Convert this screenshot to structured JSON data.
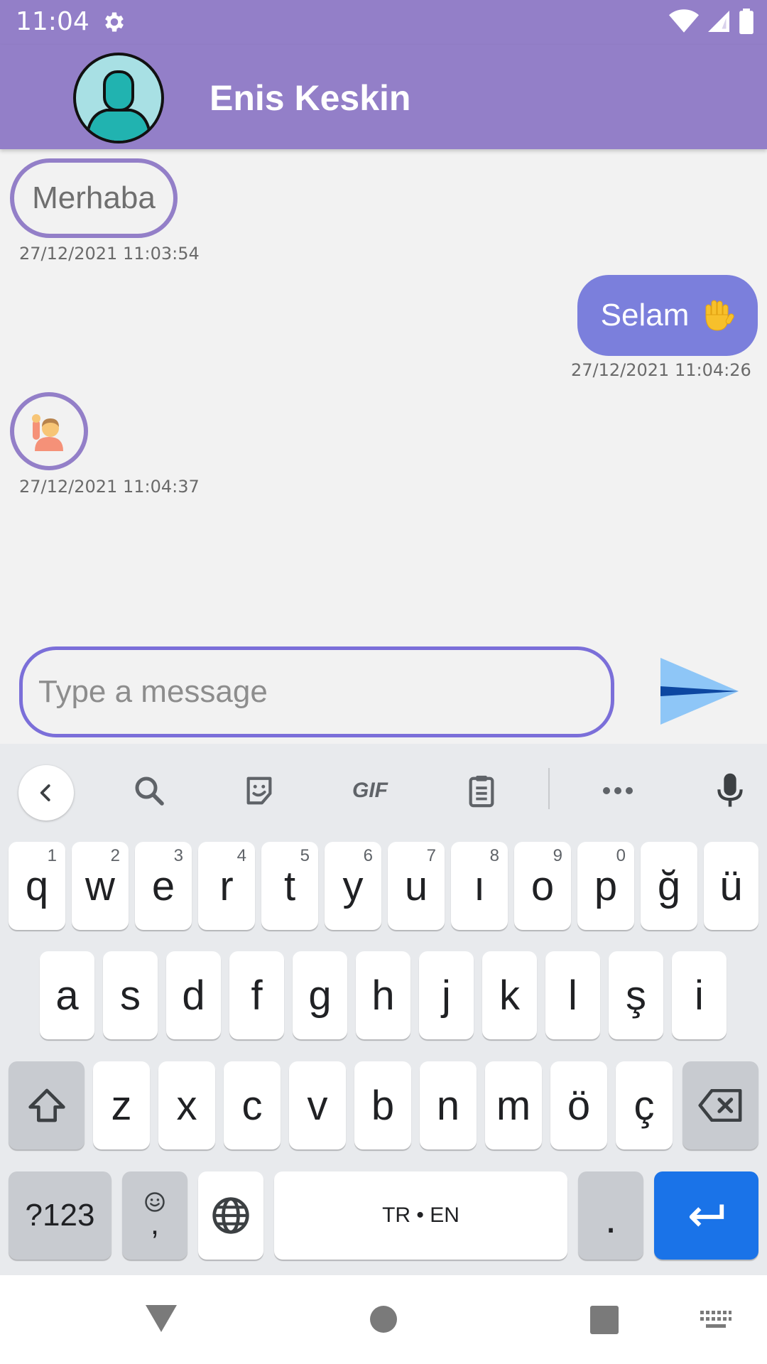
{
  "status_bar": {
    "time": "11:04"
  },
  "header": {
    "contact_name": "Enis Keskin"
  },
  "messages": [
    {
      "direction": "incoming",
      "text": "Merhaba",
      "timestamp": "27/12/2021 11:03:54"
    },
    {
      "direction": "outgoing",
      "text": "Selam",
      "emoji": "raised-hand",
      "timestamp": "27/12/2021 11:04:26"
    },
    {
      "direction": "incoming",
      "emoji": "person-raising-hand",
      "timestamp": "27/12/2021 11:04:37"
    }
  ],
  "composer": {
    "placeholder": "Type a message",
    "value": ""
  },
  "keyboard": {
    "toolbar_gif": "GIF",
    "row1": [
      {
        "key": "q",
        "hint": "1"
      },
      {
        "key": "w",
        "hint": "2"
      },
      {
        "key": "e",
        "hint": "3"
      },
      {
        "key": "r",
        "hint": "4"
      },
      {
        "key": "t",
        "hint": "5"
      },
      {
        "key": "y",
        "hint": "6"
      },
      {
        "key": "u",
        "hint": "7"
      },
      {
        "key": "ı",
        "hint": "8"
      },
      {
        "key": "o",
        "hint": "9"
      },
      {
        "key": "p",
        "hint": "0"
      },
      {
        "key": "ğ",
        "hint": ""
      },
      {
        "key": "ü",
        "hint": ""
      }
    ],
    "row2": [
      "a",
      "s",
      "d",
      "f",
      "g",
      "h",
      "j",
      "k",
      "l",
      "ş",
      "i"
    ],
    "row3": [
      "z",
      "x",
      "c",
      "v",
      "b",
      "n",
      "m",
      "ö",
      "ç"
    ],
    "symbols_label": "?123",
    "comma_label": ",",
    "space_label": "TR • EN",
    "period_label": "."
  },
  "colors": {
    "accent": "#937fc8",
    "outgoing_bubble": "#7b7fdc",
    "enter_key": "#1a73e8"
  }
}
